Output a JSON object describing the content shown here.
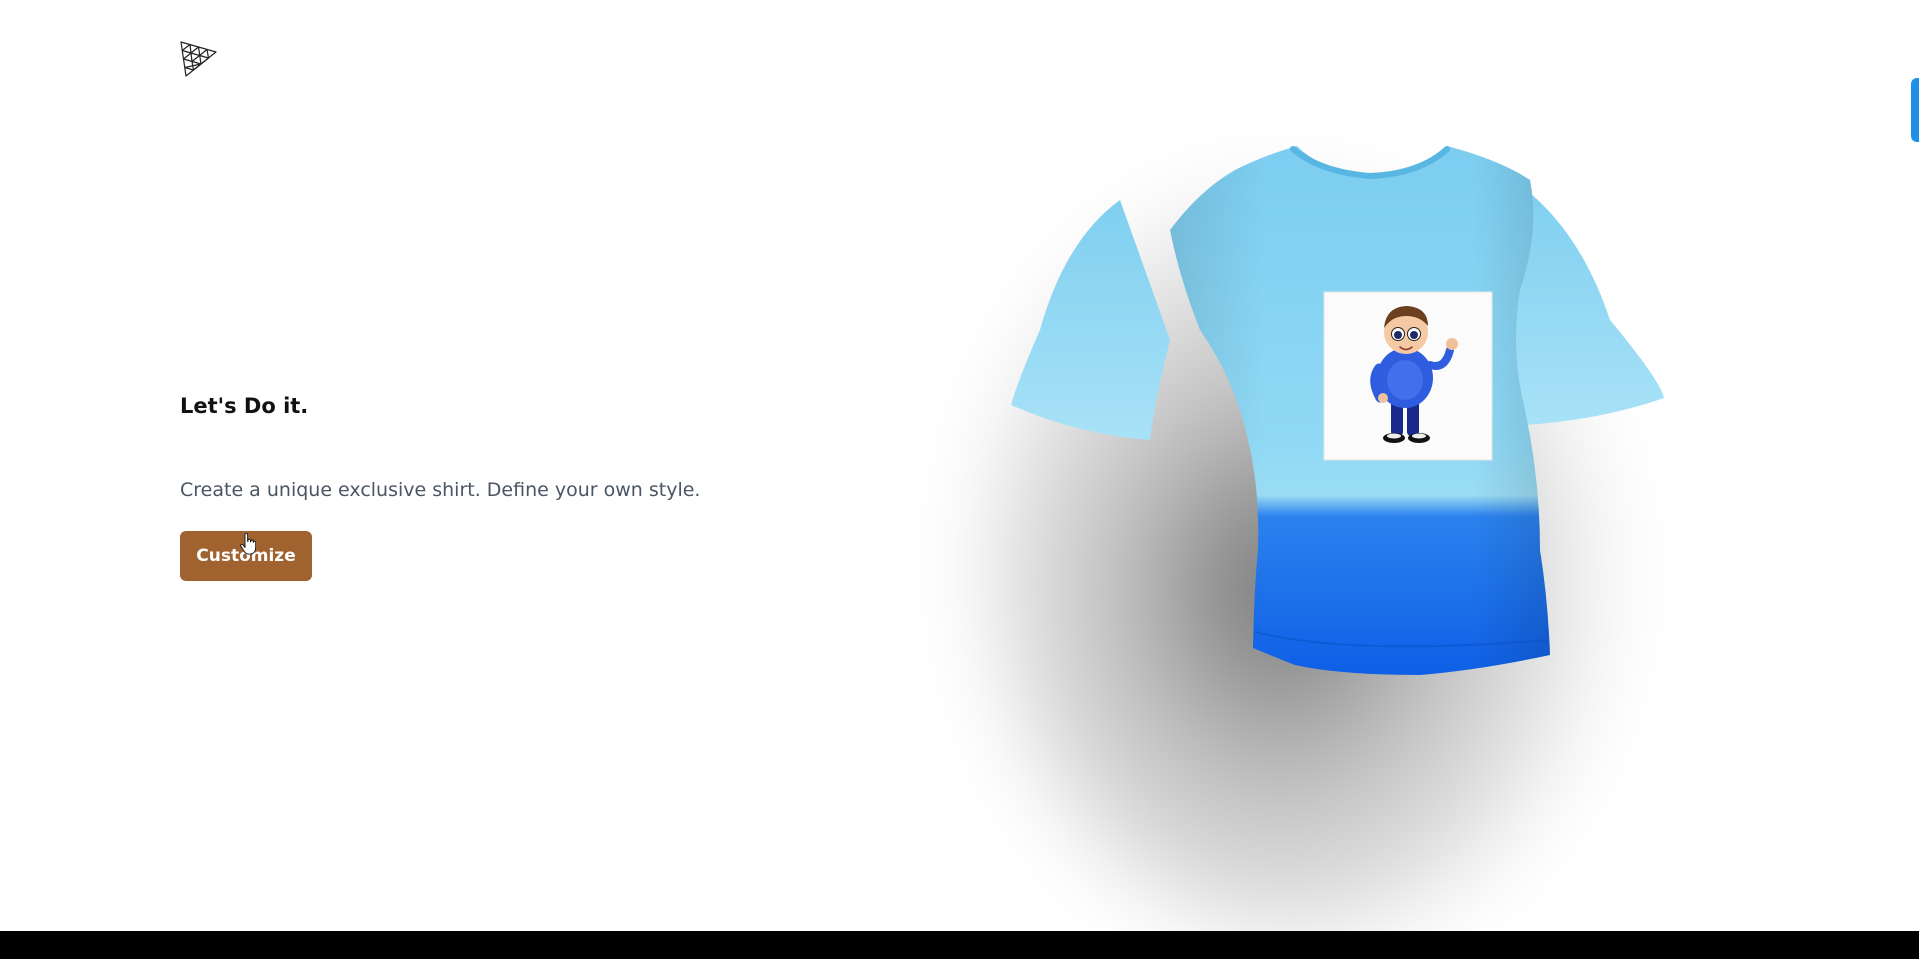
{
  "brand": {
    "logo_icon": "triangle-mesh-logo-icon"
  },
  "hero": {
    "headline": "Let's Do it.",
    "subline": "Create a unique exclusive shirt. Define your own style.",
    "cta_label": "Customize"
  },
  "shirt": {
    "body_color": "#86d4f2",
    "bottom_color": "#1766e8",
    "collar_inner_color": "#8a4a1c",
    "decal_icon": "waving-cartoon-boy-decal"
  },
  "colors": {
    "accent": "#a0622e",
    "side_tab": "#1e90e8",
    "footer": "#000000"
  }
}
